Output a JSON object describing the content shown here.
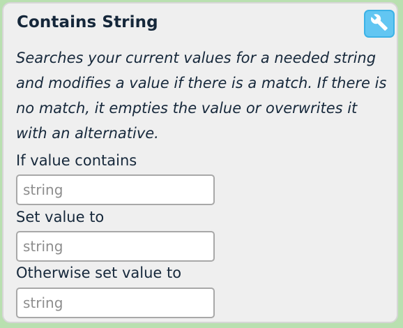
{
  "card": {
    "title": "Contains String",
    "description": "Searches your current values for a needed string and modifies a value if there is a match. If there is no match, it empties the value or overwrites it with an alternative.",
    "settings_icon": "wrench-icon"
  },
  "fields": [
    {
      "label": "If value contains",
      "value": "",
      "placeholder": "string"
    },
    {
      "label": "Set value to",
      "value": "",
      "placeholder": "string"
    },
    {
      "label": "Otherwise set value to",
      "value": "",
      "placeholder": "string"
    }
  ],
  "colors": {
    "page_background": "#b9e0b0",
    "card_background": "#efefef",
    "button_accent": "#62c6f2",
    "text": "#15273a"
  }
}
